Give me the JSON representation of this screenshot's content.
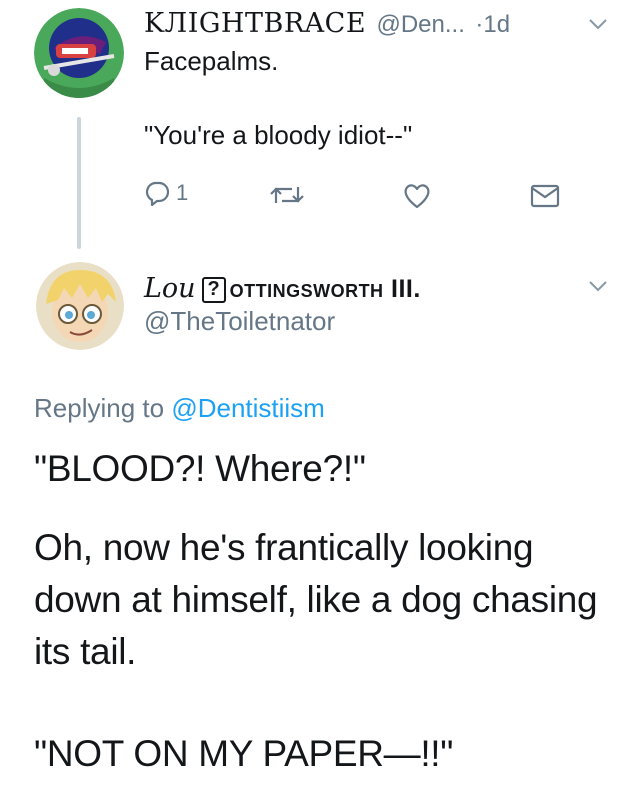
{
  "tweet1": {
    "display_name": "KЛIGHTBRACE",
    "handle": "@Den...",
    "separator": "·",
    "time": "1d",
    "line1": "Facepalms.",
    "line2": "\"You're a bloody idiot--\"",
    "reply_count": "1"
  },
  "tweet2": {
    "name_prefix": "Lou",
    "name_box": "?",
    "name_rest": "ottingsworth III.",
    "handle": "@TheToiletnator",
    "replying_to_label": "Replying to",
    "replying_to_handle": "@Dentistiism",
    "paragraphs": [
      "\"BLOOD?! Where?!\"",
      "Oh, now he's frantically looking down at himself, like a dog chasing its tail.",
      "\"NOT ON MY PAPER—!!\""
    ]
  },
  "icons": {
    "reply": "reply-icon",
    "retweet": "retweet-icon",
    "like": "heart-icon",
    "dm": "envelope-icon",
    "menu": "chevron-down-icon"
  },
  "colors": {
    "text": "#14171a",
    "muted": "#657786",
    "link": "#1da1f2",
    "thread_line": "#ccd6dd"
  }
}
